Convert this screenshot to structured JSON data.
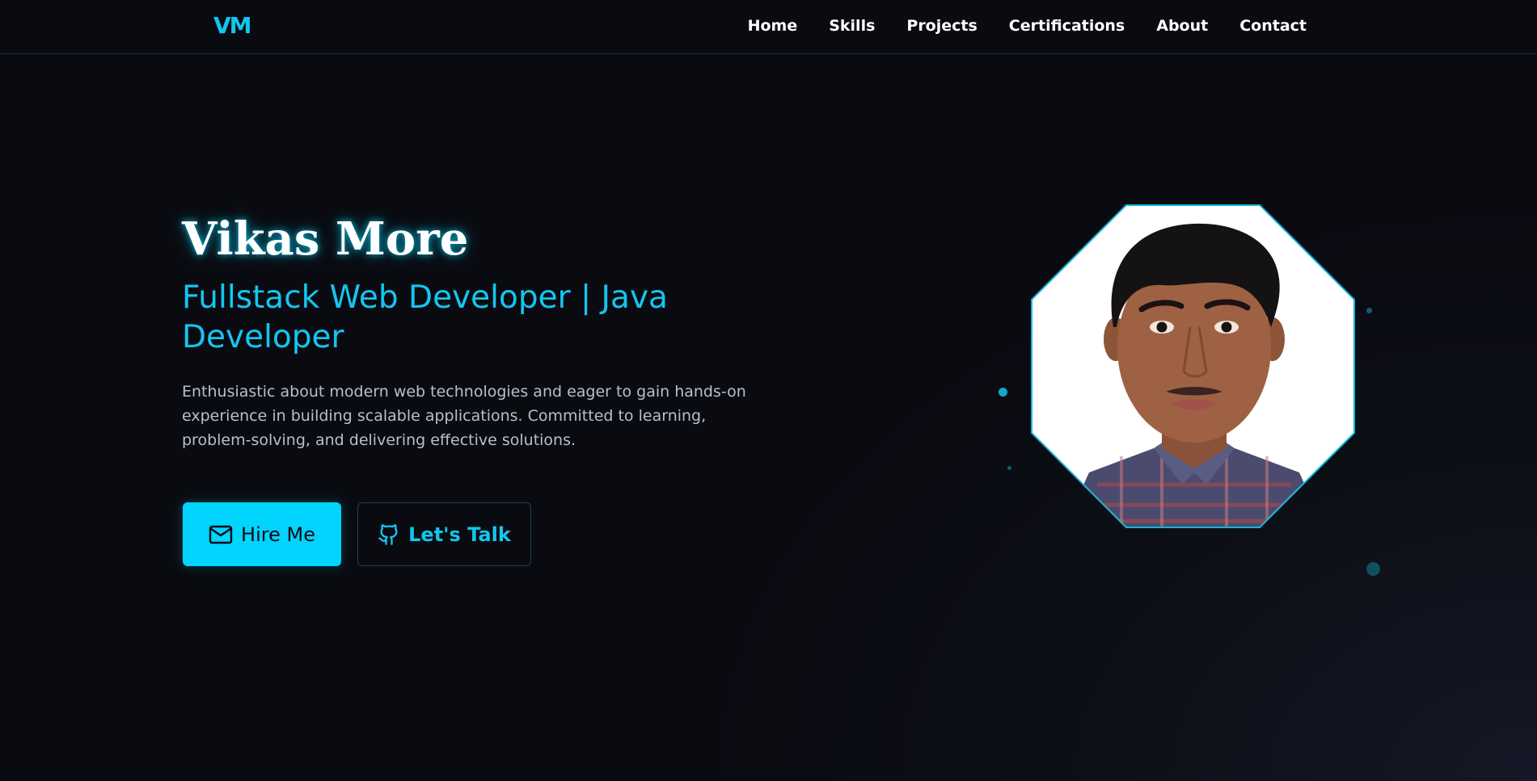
{
  "nav": {
    "logo": "VM",
    "links": [
      "Home",
      "Skills",
      "Projects",
      "Certifications",
      "About",
      "Contact"
    ]
  },
  "hero": {
    "name": "Vikas More",
    "title": "Fullstack Web Developer | Java Developer",
    "description": "Enthusiastic about modern web technologies and eager to gain hands-on experience in building scalable applications. Committed to learning, problem-solving, and delivering effective solutions.",
    "hire_label": "Hire Me",
    "talk_label": "Let's Talk",
    "hire_icon": "mail-icon",
    "talk_icon": "github-icon"
  },
  "profile": {
    "photo": "profile-photo"
  },
  "colors": {
    "accent": "#00d4ff",
    "background": "#0b0c12",
    "navbar": "#0a0b10",
    "text": "#ffffff",
    "muted": "#b9bfca"
  }
}
